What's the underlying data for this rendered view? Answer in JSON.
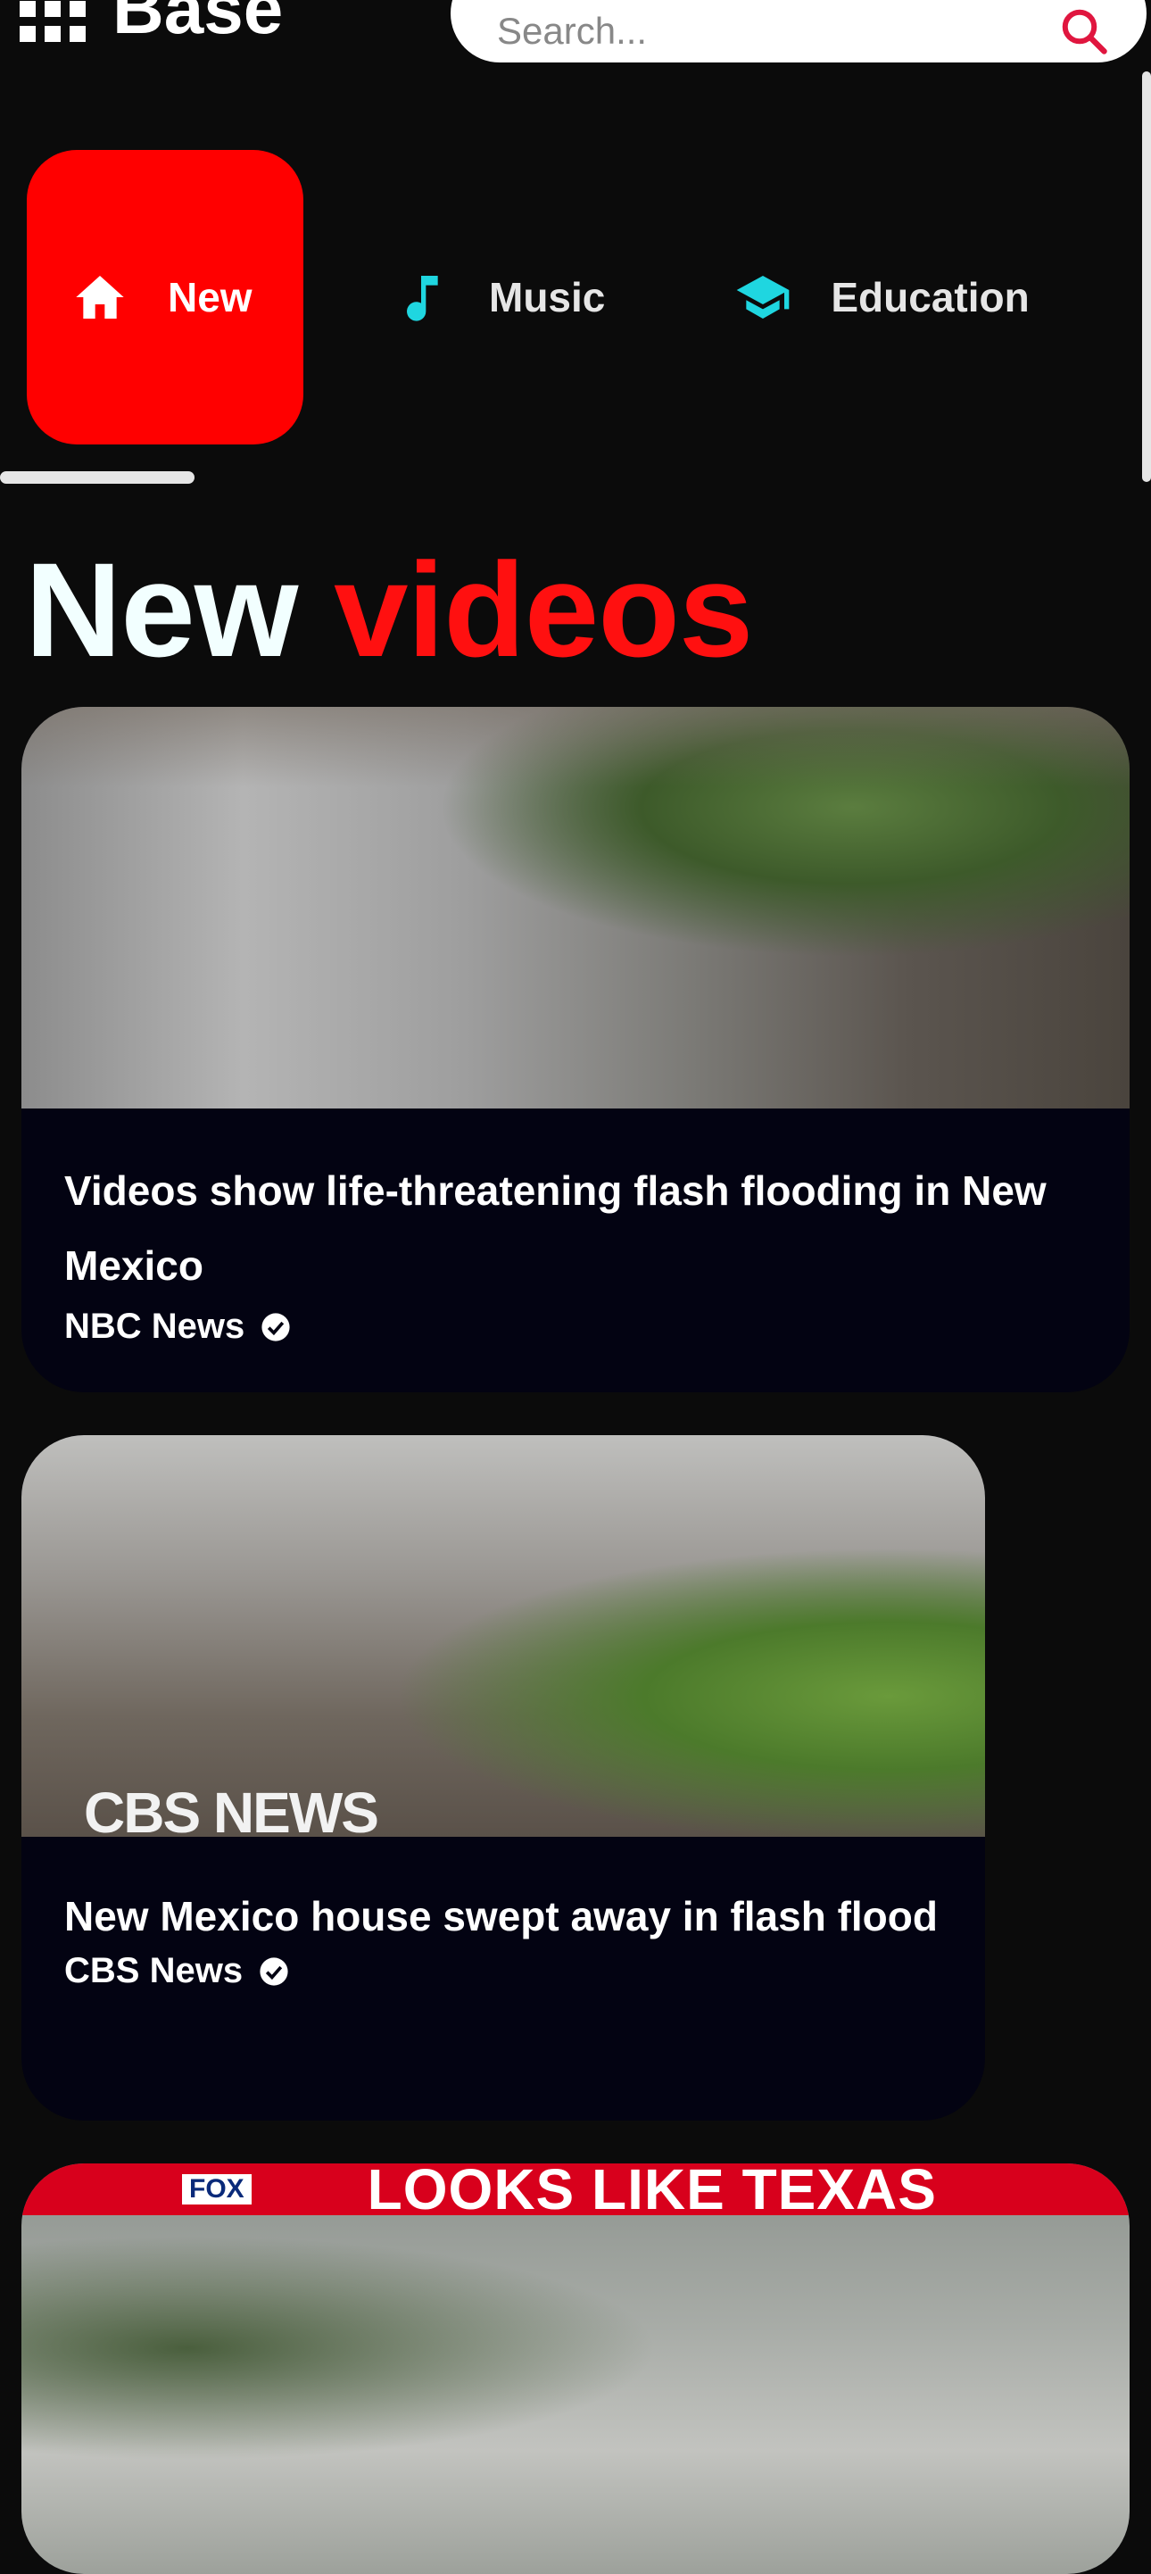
{
  "header": {
    "app_name": "Base",
    "search_placeholder": "Search..."
  },
  "tabs": [
    {
      "label": "New",
      "icon": "home-icon",
      "active": true
    },
    {
      "label": "Music",
      "icon": "music-note-icon",
      "active": false
    },
    {
      "label": "Education",
      "icon": "graduation-cap-icon",
      "active": false
    }
  ],
  "section": {
    "title_part1": "New",
    "title_part2": "videos"
  },
  "videos": [
    {
      "title": "Videos show life-threatening flash flooding in New Mexico",
      "channel": "NBC News",
      "verified": true
    },
    {
      "title": "New Mexico house swept away in flash flood",
      "channel": "CBS News",
      "verified": true,
      "thumbnail_watermark": "CBS NEWS"
    },
    {
      "thumbnail_logo": "FOX",
      "thumbnail_banner": "LOOKS LIKE TEXAS"
    }
  ],
  "colors": {
    "accent": "#ff0000",
    "background": "#0b0b0b",
    "card_background": "#030312",
    "music_icon": "#1fd6e0",
    "education_icon": "#1fd6e0"
  }
}
